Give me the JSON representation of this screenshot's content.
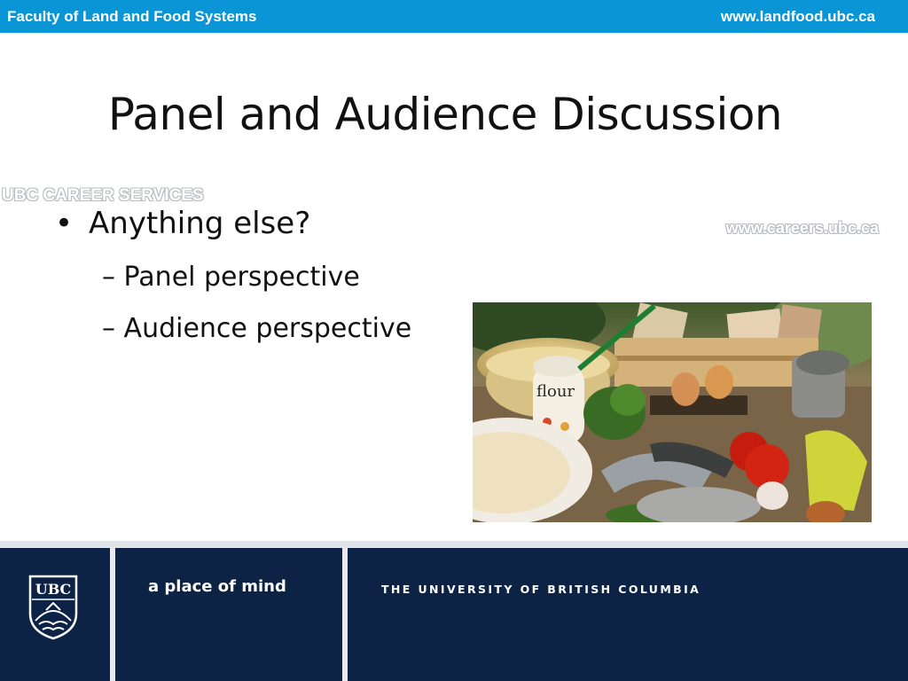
{
  "header": {
    "faculty": "Faculty of Land and Food Systems",
    "website": "www.landfood.ubc.ca"
  },
  "slide": {
    "title": "Panel and Audience Discussion",
    "watermark_left": "UBC CAREER SERVICES",
    "watermark_right": "www.careers.ubc.ca",
    "bullets": [
      {
        "text": "Anything else?",
        "subitems": [
          {
            "text": "Panel perspective"
          },
          {
            "text": "Audience perspective"
          }
        ]
      }
    ],
    "photo_label": "flour"
  },
  "footer": {
    "crest_text": "UBC",
    "tagline": "a place of mind",
    "university": "THE UNIVERSITY OF BRITISH COLUMBIA"
  },
  "colors": {
    "top_bar": "#0a96d6",
    "footer": "#0c2345"
  }
}
